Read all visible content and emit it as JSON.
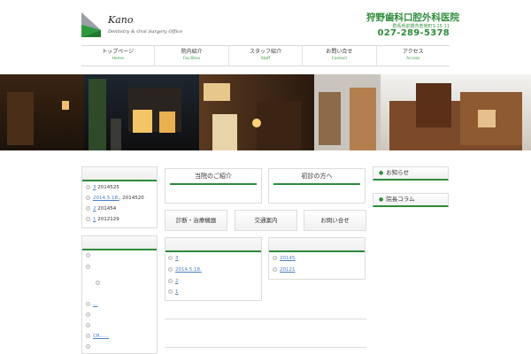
{
  "header": {
    "logo_name": "Kano",
    "logo_sub": "Dentistry & Oral Surgery Office",
    "clinic_name": "狩野歯科口腔外科医院",
    "address": "群馬県前橋市若宮町3-15-11",
    "tel": "027-289-5378"
  },
  "nav": [
    {
      "jp": "トップページ",
      "en": "Home"
    },
    {
      "jp": "院内紹介",
      "en": "Facilities"
    },
    {
      "jp": "スタッフ紹介",
      "en": "Staff"
    },
    {
      "jp": "お問い合せ",
      "en": "Contact"
    },
    {
      "jp": "アクセス",
      "en": "Access"
    }
  ],
  "sidebar_top": [
    {
      "num": "3",
      "text": "2014525"
    },
    {
      "num": "2014.5.18.",
      "text": "2014520"
    },
    {
      "num": "2",
      "text": "201454"
    },
    {
      "num": "1",
      "text": "2012129"
    }
  ],
  "sidebar_bottom": [
    "",
    "",
    "",
    "...",
    "",
    "",
    "CR......",
    ""
  ],
  "main": {
    "intro_card": "当院のご紹介",
    "first_visit_card": "初診の方へ",
    "buttons": [
      "診断・治療機器",
      "交通案内",
      "お問い合せ"
    ],
    "left_list": [
      "3",
      "2014.5.18.",
      "2",
      "1"
    ],
    "right_list": [
      "20145",
      "20121"
    ]
  },
  "right_sidebar": {
    "news": "お知らせ",
    "column": "院長コラム"
  },
  "colors": {
    "accent": "#2e8b3a"
  }
}
